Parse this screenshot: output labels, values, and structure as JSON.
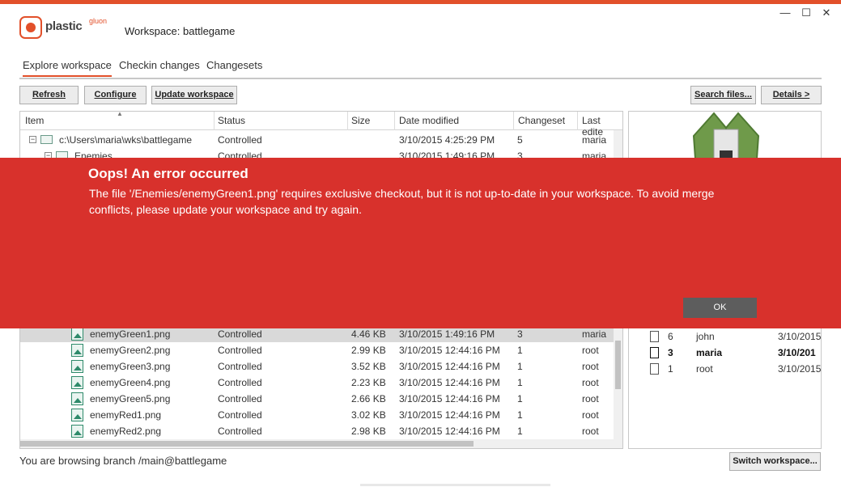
{
  "app": {
    "logo_text": "plastic",
    "logo_sup": "gluon",
    "workspace_title": "Workspace: battlegame",
    "minimize_glyph": "—",
    "maximize_glyph": "☐",
    "close_glyph": "✕"
  },
  "tabs": [
    {
      "label": "Explore workspace"
    },
    {
      "label": "Checkin changes"
    },
    {
      "label": "Changesets"
    }
  ],
  "toolbar": {
    "refresh": "Refresh",
    "configure": "Configure",
    "update": "Update workspace",
    "search": "Search files...",
    "details": "Details >"
  },
  "grid": {
    "columns": [
      "Item",
      "Status",
      "Size",
      "Date modified",
      "Changeset",
      "Last edite"
    ],
    "sort_glyph": "▲",
    "rows": [
      {
        "item": "c:\\Users\\maria\\wks\\battlegame",
        "status": "Controlled",
        "size": "",
        "date": "3/10/2015 4:25:29 PM",
        "changeset": "5",
        "last": "maria"
      },
      {
        "item": "Enemies",
        "status": "Controlled",
        "size": "",
        "date": "3/10/2015 1:49:16 PM",
        "changeset": "3",
        "last": "maria"
      },
      {
        "item": "enemyGreen1.png",
        "status": "Controlled",
        "size": "4.46 KB",
        "date": "3/10/2015 1:49:16 PM",
        "changeset": "3",
        "last": "maria"
      },
      {
        "item": "enemyGreen2.png",
        "status": "Controlled",
        "size": "2.99 KB",
        "date": "3/10/2015 12:44:16 PM",
        "changeset": "1",
        "last": "root"
      },
      {
        "item": "enemyGreen3.png",
        "status": "Controlled",
        "size": "3.52 KB",
        "date": "3/10/2015 12:44:16 PM",
        "changeset": "1",
        "last": "root"
      },
      {
        "item": "enemyGreen4.png",
        "status": "Controlled",
        "size": "2.23 KB",
        "date": "3/10/2015 12:44:16 PM",
        "changeset": "1",
        "last": "root"
      },
      {
        "item": "enemyGreen5.png",
        "status": "Controlled",
        "size": "2.66 KB",
        "date": "3/10/2015 12:44:16 PM",
        "changeset": "1",
        "last": "root"
      },
      {
        "item": "enemyRed1.png",
        "status": "Controlled",
        "size": "3.02 KB",
        "date": "3/10/2015 12:44:16 PM",
        "changeset": "1",
        "last": "root"
      },
      {
        "item": "enemyRed2.png",
        "status": "Controlled",
        "size": "2.98 KB",
        "date": "3/10/2015 12:44:16 PM",
        "changeset": "1",
        "last": "root"
      }
    ]
  },
  "history": [
    {
      "cs": "6",
      "user": "john",
      "date": "3/10/2015"
    },
    {
      "cs": "3",
      "user": "maria",
      "date": "3/10/201"
    },
    {
      "cs": "1",
      "user": "root",
      "date": "3/10/2015"
    }
  ],
  "status_bar": {
    "branch_text": "You are browsing branch /main@battlegame",
    "switch_button": "Switch workspace..."
  },
  "error": {
    "title": "Oops! An error occurred",
    "message": "The file '/Enemies/enemyGreen1.png' requires exclusive checkout, but it is not up-to-date in your workspace. To avoid merge conflicts, please update your workspace and try again.",
    "ok_label": "OK"
  },
  "colors": {
    "accent": "#e2502a",
    "error_bg": "#d8312c",
    "ok_button": "#5d5d5d",
    "selected_row": "#d9d9d9"
  },
  "icons": [
    "plastic-logo-icon",
    "expander-icon",
    "folder-icon",
    "image-file-icon",
    "document-icon",
    "sort-arrow-icon"
  ]
}
